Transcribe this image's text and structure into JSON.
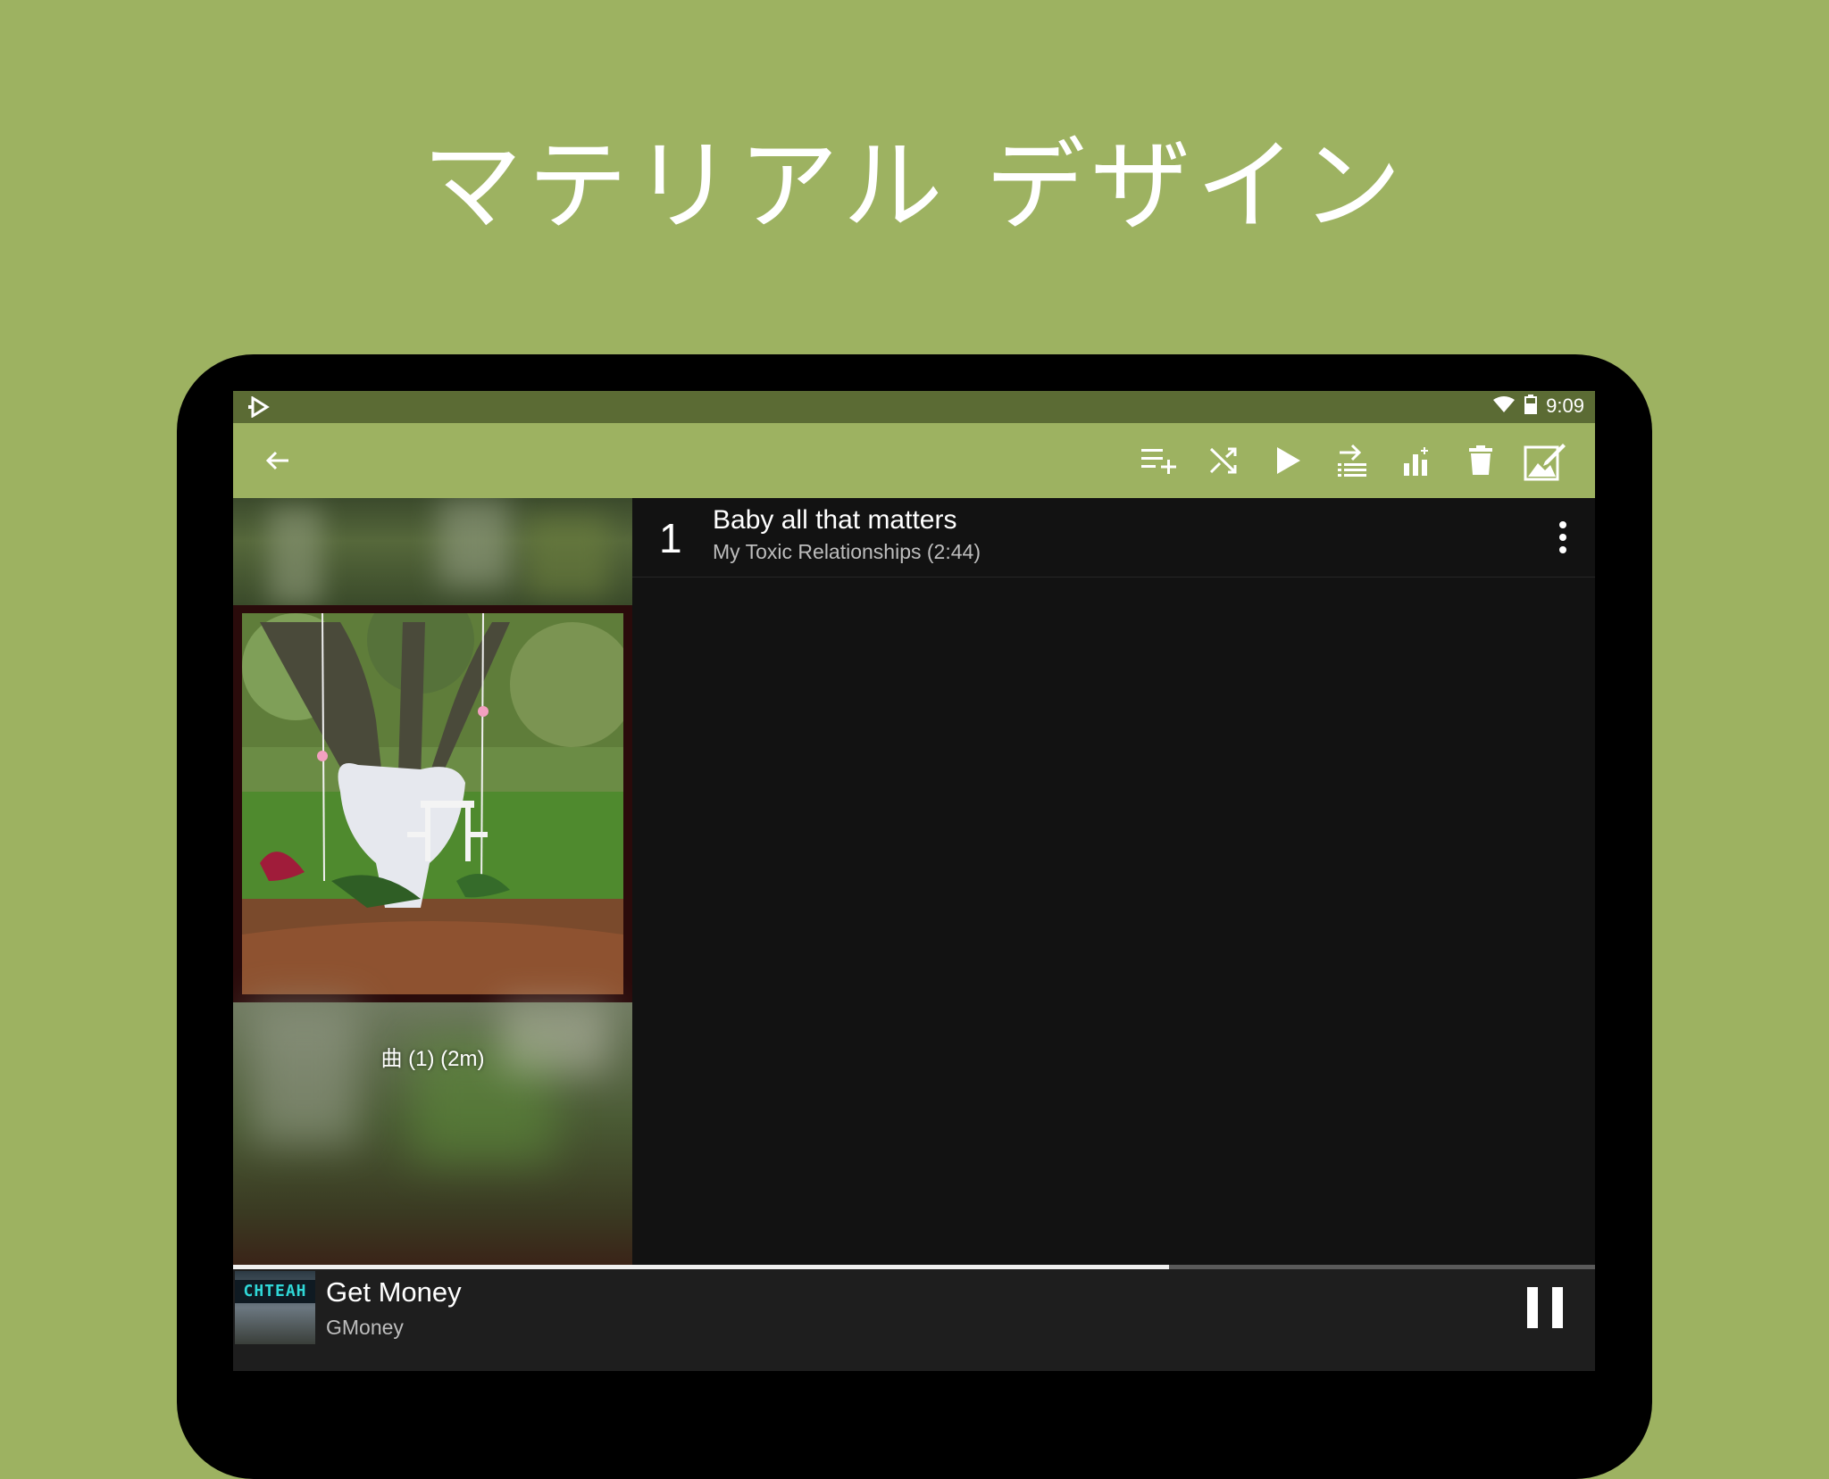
{
  "promo": {
    "headline": "マテリアル デザイン"
  },
  "status_bar": {
    "time": "9:09",
    "icons": [
      "app-logo-icon",
      "wifi-icon",
      "battery-icon"
    ]
  },
  "toolbar": {
    "back_icon": "arrow-back-icon",
    "actions": [
      {
        "name": "add-to-queue-button",
        "icon": "playlist-add-icon"
      },
      {
        "name": "shuffle-button",
        "icon": "shuffle-icon"
      },
      {
        "name": "play-button",
        "icon": "play-icon"
      },
      {
        "name": "queue-next-button",
        "icon": "queue-list-icon"
      },
      {
        "name": "equalizer-button",
        "icon": "equalizer-icon"
      },
      {
        "name": "delete-button",
        "icon": "trash-icon"
      },
      {
        "name": "edit-artwork-button",
        "icon": "edit-image-icon"
      }
    ]
  },
  "album": {
    "meta": "曲 (1) (2m)"
  },
  "tracks": [
    {
      "number": "1",
      "title": "Baby all that matters",
      "subtitle": "My Toxic Relationships (2:44)"
    }
  ],
  "now_playing": {
    "title": "Get Money",
    "artist": "GMoney",
    "thumb_text": "CHTEAH",
    "progress": 0.687
  },
  "colors": {
    "background": "#9db261",
    "status_bar": "#5b6b34",
    "toolbar": "#9db261",
    "content": "#121212",
    "now_playing": "#1e1e1e"
  }
}
